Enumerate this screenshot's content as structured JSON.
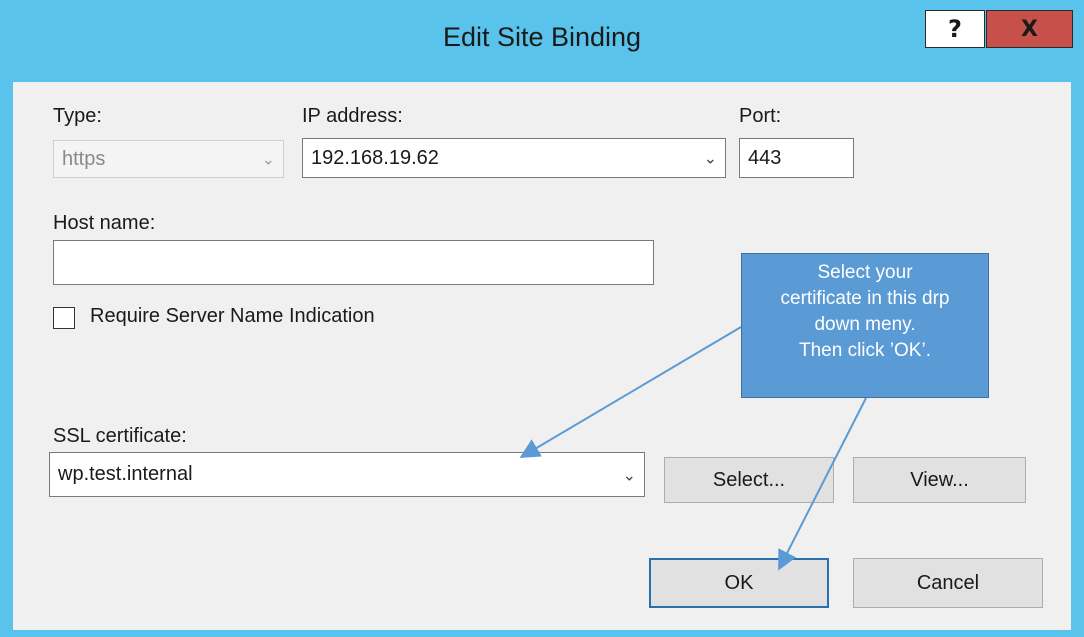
{
  "window": {
    "title": "Edit Site Binding",
    "help_label": "?",
    "close_label": "X"
  },
  "fields": {
    "type_label": "Type:",
    "type_value": "https",
    "ip_label": "IP address:",
    "ip_value": "192.168.19.62",
    "port_label": "Port:",
    "port_value": "443",
    "host_label": "Host name:",
    "host_value": "",
    "sni_label": "Require Server Name Indication",
    "ssl_label": "SSL certificate:",
    "ssl_value": "wp.test.internal"
  },
  "buttons": {
    "select": "Select...",
    "view": "View...",
    "ok": "OK",
    "cancel": "Cancel"
  },
  "callout": {
    "lines": [
      "Select your",
      "certificate in this drp",
      "down meny.",
      "Then click ’OK’."
    ]
  },
  "colors": {
    "titlebar": "#5ac3ec",
    "close": "#c8504a",
    "callout": "#5b9bd5"
  }
}
